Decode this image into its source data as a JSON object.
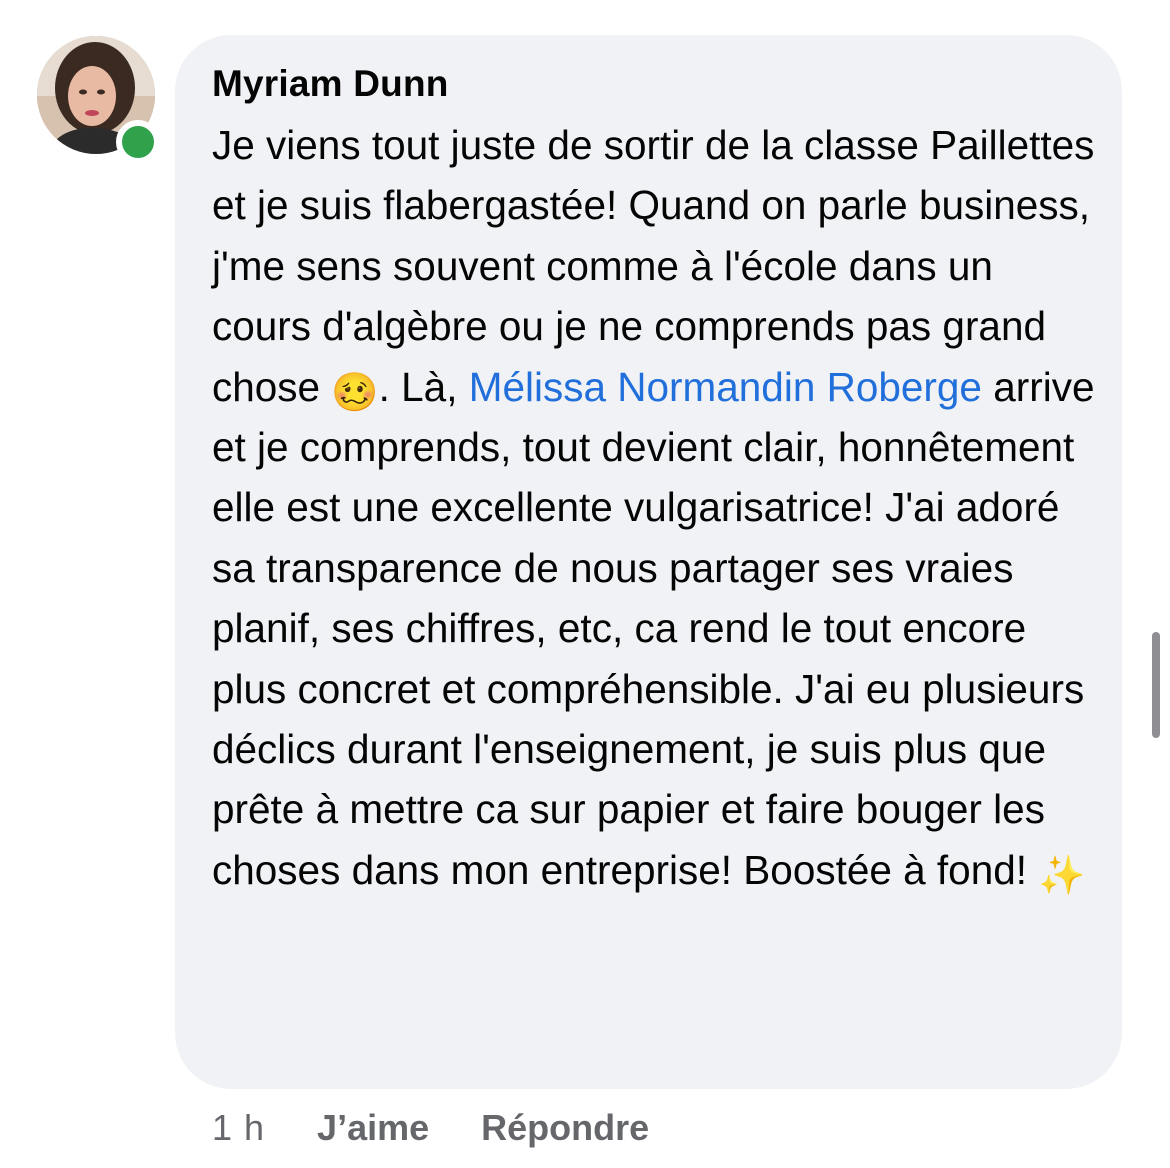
{
  "comment": {
    "author": "Myriam Dunn",
    "avatar_icon": "profile-photo",
    "presence_status": "online",
    "presence_color": "#31a24c",
    "text_part1": "Je viens tout juste de sortir de la classe Paillettes et je suis flabergastée! Quand on parle business, j'me sens souvent comme à l'école dans un cours d'algèbre ou je ne comprends pas grand chose ",
    "emoji_1": "🥴",
    "text_part2": ". Là, ",
    "mention": "Mélissa Normandin Roberge",
    "text_part3": " arrive et je comprends, tout devient clair, honnêtement elle est une excellente vulgarisatrice! J'ai adoré sa transparence de nous partager ses vraies planif, ses chiffres, etc, ca rend le tout encore plus concret et compréhensible. J'ai eu plusieurs déclics durant l'enseignement, je suis plus que prête à mettre ca sur papier et faire bouger les choses dans mon entreprise! Boostée à fond! ",
    "emoji_2": "✨",
    "mention_color": "#216fdb",
    "bubble_color": "#f0f2f5"
  },
  "actions": {
    "timestamp": "1 h",
    "like_label": "J’aime",
    "reply_label": "Répondre"
  }
}
